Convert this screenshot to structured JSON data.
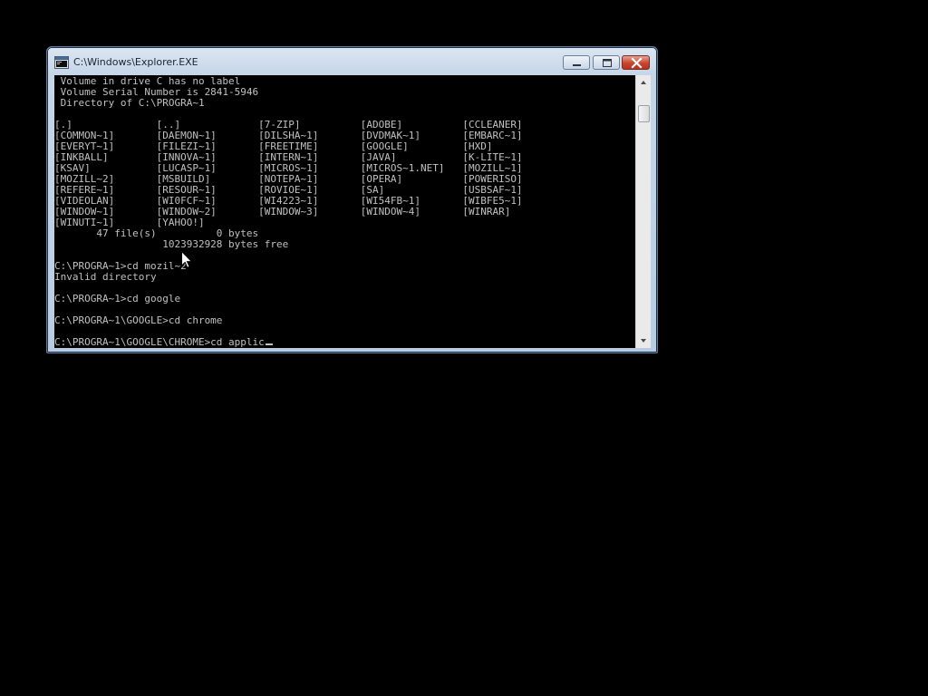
{
  "window": {
    "title": "C:\\Windows\\Explorer.EXE"
  },
  "console": {
    "lines": [
      " Volume in drive C has no label",
      " Volume Serial Number is 2841-5946",
      " Directory of C:\\PROGRA~1",
      "",
      "[.]              [..]             [7-ZIP]          [ADOBE]          [CCLEANER]",
      "[COMMON~1]       [DAEMON~1]       [DILSHA~1]       [DVDMAK~1]       [EMBARC~1]",
      "[EVERYT~1]       [FILEZI~1]       [FREETIME]       [GOOGLE]         [HXD]",
      "[INKBALL]        [INNOVA~1]       [INTERN~1]       [JAVA]           [K-LITE~1]",
      "[KSAV]           [LUCASP~1]       [MICROS~1]       [MICROS~1.NET]   [MOZILL~1]",
      "[MOZILL~2]       [MSBUILD]        [NOTEPA~1]       [OPERA]          [POWERISO]",
      "[REFERE~1]       [RESOUR~1]       [ROVIOE~1]       [SA]             [USBSAF~1]",
      "[VIDEOLAN]       [WI0FCF~1]       [WI4223~1]       [WI54FB~1]       [WIBFE5~1]",
      "[WINDOW~1]       [WINDOW~2]       [WINDOW~3]       [WINDOW~4]       [WINRAR]",
      "[WINUTI~1]       [YAHOO!]",
      "       47 file(s)          0 bytes",
      "                  1023932928 bytes free",
      "",
      "C:\\PROGRA~1>cd mozil~2",
      "Invalid directory",
      "",
      "C:\\PROGRA~1>cd google",
      "",
      "C:\\PROGRA~1\\GOOGLE>cd chrome",
      ""
    ],
    "prompt_line": "C:\\PROGRA~1\\GOOGLE\\CHROME>cd applic"
  }
}
